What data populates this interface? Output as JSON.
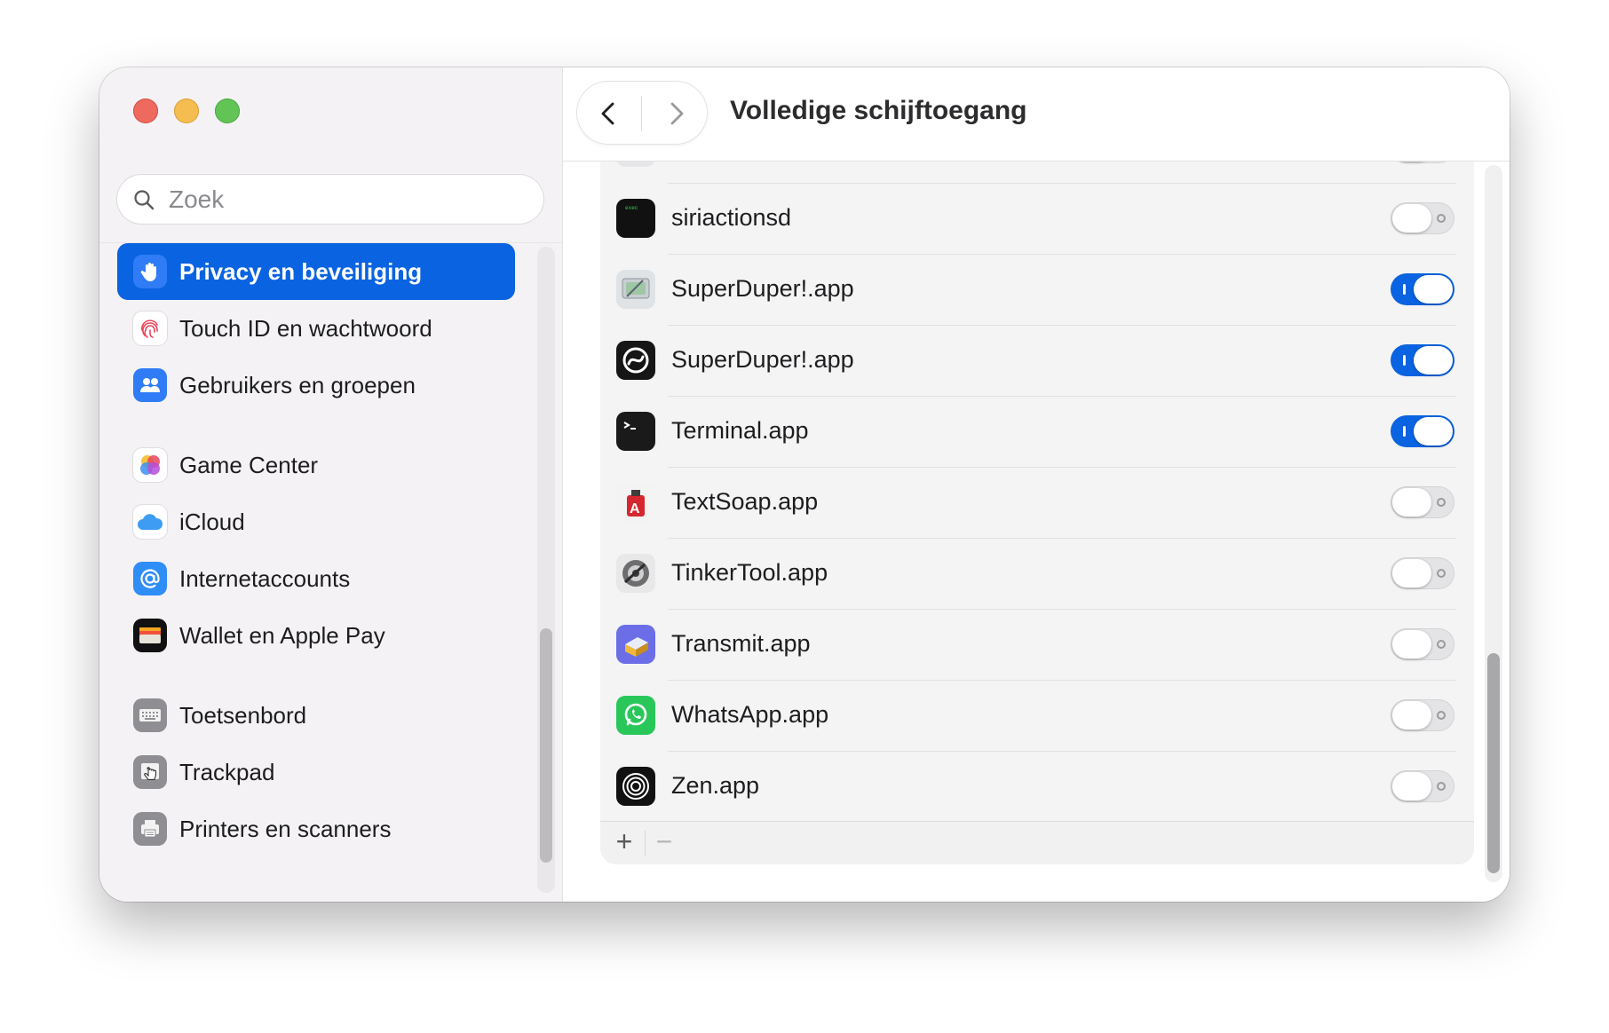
{
  "window": {
    "title": "Volledige schijftoegang"
  },
  "sidebar": {
    "search_placeholder": "Zoek",
    "items": [
      {
        "label": "Privacy en beveiliging",
        "icon": "hand-icon",
        "active": true
      },
      {
        "label": "Touch ID en wachtwoord",
        "icon": "fingerprint-icon"
      },
      {
        "label": "Gebruikers en groepen",
        "icon": "users-icon"
      },
      {
        "label": "Game Center",
        "icon": "game-center-icon"
      },
      {
        "label": "iCloud",
        "icon": "icloud-icon"
      },
      {
        "label": "Internetaccounts",
        "icon": "at-icon"
      },
      {
        "label": "Wallet en Apple Pay",
        "icon": "wallet-icon"
      },
      {
        "label": "Toetsenbord",
        "icon": "keyboard-icon"
      },
      {
        "label": "Trackpad",
        "icon": "trackpad-icon"
      },
      {
        "label": "Printers en scanners",
        "icon": "printer-icon"
      }
    ]
  },
  "apps": [
    {
      "name": "siriactionsd",
      "icon": "exec-icon",
      "enabled": false
    },
    {
      "name": "SuperDuper!.app",
      "icon": "superduper-disk-icon",
      "enabled": true
    },
    {
      "name": "SuperDuper!.app",
      "icon": "superduper-icon",
      "enabled": true
    },
    {
      "name": "Terminal.app",
      "icon": "terminal-icon",
      "enabled": true
    },
    {
      "name": "TextSoap.app",
      "icon": "textsoap-icon",
      "enabled": false
    },
    {
      "name": "TinkerTool.app",
      "icon": "tinkertool-icon",
      "enabled": false
    },
    {
      "name": "Transmit.app",
      "icon": "transmit-icon",
      "enabled": false
    },
    {
      "name": "WhatsApp.app",
      "icon": "whatsapp-icon",
      "enabled": false
    },
    {
      "name": "Zen.app",
      "icon": "zen-icon",
      "enabled": false
    }
  ],
  "list_controls": {
    "add_label": "+",
    "remove_label": "−"
  },
  "colors": {
    "accent": "#0a63e0",
    "close": "#ee6a5f",
    "minimize": "#f5bd4f",
    "maximize": "#61c454"
  }
}
